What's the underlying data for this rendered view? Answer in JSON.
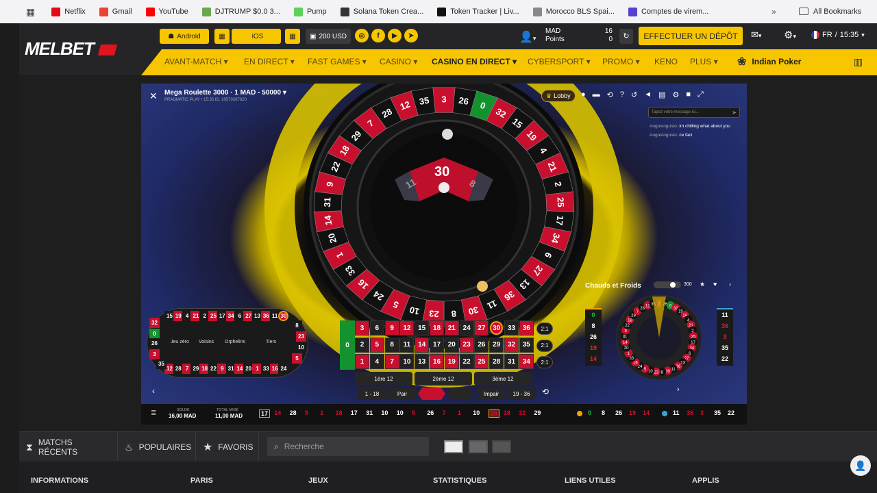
{
  "browser": {
    "bookmarks": [
      {
        "label": "Netflix",
        "icon": "netflix-icon",
        "color": "#e50914"
      },
      {
        "label": "Gmail",
        "icon": "gmail-icon",
        "color": "#ea4335"
      },
      {
        "label": "YouTube",
        "icon": "youtube-icon",
        "color": "#ff0000"
      },
      {
        "label": "DJTRUMP $0.0 3...",
        "icon": "frog-icon",
        "color": "#6aa84f"
      },
      {
        "label": "Pump",
        "icon": "pill-icon",
        "color": "#5bd15b"
      },
      {
        "label": "Solana Token Crea...",
        "icon": "solana-icon",
        "color": "#333"
      },
      {
        "label": "Token Tracker | Liv...",
        "icon": "token-icon",
        "color": "#111"
      },
      {
        "label": "Morocco BLS Spai...",
        "icon": "bls-icon",
        "color": "#888"
      },
      {
        "label": "Comptes de virem...",
        "icon": "account-icon",
        "color": "#5b3fd1"
      }
    ],
    "all_bookmarks": "All Bookmarks"
  },
  "header": {
    "logo": "MELBET",
    "android": "Android",
    "ios": "iOS",
    "bonus": "200 USD",
    "currency": "MAD",
    "points": "Points",
    "balance": "16",
    "points_value": "0",
    "deposit": "EFFECTUER UN DÉPÔT",
    "lang": "FR",
    "time": "15:35"
  },
  "nav": {
    "items": [
      "AVANT-MATCH",
      "EN DIRECT",
      "FAST GAMES",
      "CASINO",
      "CASINO EN DIRECT",
      "CYBERSPORT",
      "PROMO",
      "KENO",
      "PLUS"
    ],
    "special": "Indian Poker"
  },
  "game": {
    "title": "Mega Roulette 3000 · 1 MAD - 50000",
    "subtitle": "PRAGMATIC PLAY • 15:35 ID: 10570267620",
    "lobby": "Lobby",
    "chat_placeholder": "Tapez votre message ici...",
    "chat": [
      {
        "user": "Augustogusto:",
        "msg": "im chilling what about you"
      },
      {
        "user": "Augustogusto:",
        "msg": "ce faci"
      }
    ],
    "result": "30",
    "result_left": "11",
    "result_right": "8",
    "hot_cold_title": "Chauds et Froids",
    "hot_cold_count": "300",
    "hot_left": [
      "0",
      "8",
      "26",
      "19",
      "14"
    ],
    "cold_right": [
      "11",
      "36",
      "3",
      "35",
      "22"
    ],
    "race_labels": [
      "Jeu zéro",
      "Voisins",
      "Orphelins",
      "Tiers"
    ],
    "race_top": [
      "15",
      "19",
      "4",
      "21",
      "2",
      "25",
      "17",
      "34",
      "6",
      "27",
      "13",
      "36",
      "11",
      "30"
    ],
    "race_bottom": [
      "12",
      "28",
      "7",
      "29",
      "18",
      "22",
      "9",
      "31",
      "14",
      "20",
      "1",
      "33",
      "16",
      "24"
    ],
    "race_left": [
      "32",
      "0",
      "26",
      "3",
      "35"
    ],
    "race_right": [
      "8",
      "23",
      "10",
      "5"
    ],
    "board_rows": [
      [
        "3",
        "6",
        "9",
        "12",
        "15",
        "18",
        "21",
        "24",
        "27",
        "30",
        "33",
        "36"
      ],
      [
        "2",
        "5",
        "8",
        "11",
        "14",
        "17",
        "20",
        "23",
        "26",
        "29",
        "32",
        "35"
      ],
      [
        "1",
        "4",
        "7",
        "10",
        "13",
        "16",
        "19",
        "22",
        "25",
        "28",
        "31",
        "34"
      ]
    ],
    "column_label": "2:1",
    "dozens": [
      "1ère 12",
      "2ème 12",
      "3ème 12"
    ],
    "outside": [
      "1 - 18",
      "Pair",
      "Impair",
      "19 - 36"
    ],
    "balance_label": "SOLDE",
    "balance_value": "16,00 MAD",
    "bet_label": "TOTAL MISÉ",
    "bet_value": "11,00 MAD",
    "history": [
      "17",
      "14",
      "28",
      "5",
      "1",
      "18",
      "17",
      "31",
      "10",
      "10",
      "5",
      "26",
      "7",
      "1",
      "10",
      "30",
      "18",
      "32",
      "29"
    ],
    "history_right_a": [
      "0",
      "8",
      "26",
      "19",
      "14"
    ],
    "history_right_b": [
      "11",
      "36",
      "3",
      "35",
      "22"
    ],
    "wheel_numbers": [
      "3",
      "26",
      "0",
      "32",
      "15",
      "19",
      "4",
      "21",
      "2",
      "25",
      "17",
      "34",
      "6",
      "27",
      "13",
      "36",
      "11",
      "30",
      "8",
      "23",
      "10",
      "5",
      "24",
      "16",
      "33",
      "1",
      "20",
      "14",
      "31",
      "9",
      "22",
      "18",
      "29",
      "7",
      "28",
      "12",
      "35"
    ]
  },
  "footer": {
    "tabs": [
      "MATCHS RÉCENTS",
      "POPULAIRES",
      "FAVORIS"
    ],
    "search_placeholder": "Recherche",
    "columns": [
      "INFORMATIONS",
      "PARIS",
      "JEUX",
      "STATISTIQUES",
      "LIENS UTILES",
      "APPLIS"
    ]
  },
  "colors": {
    "accent": "#f7c600",
    "red": "#c8102e",
    "green": "#14922e"
  }
}
